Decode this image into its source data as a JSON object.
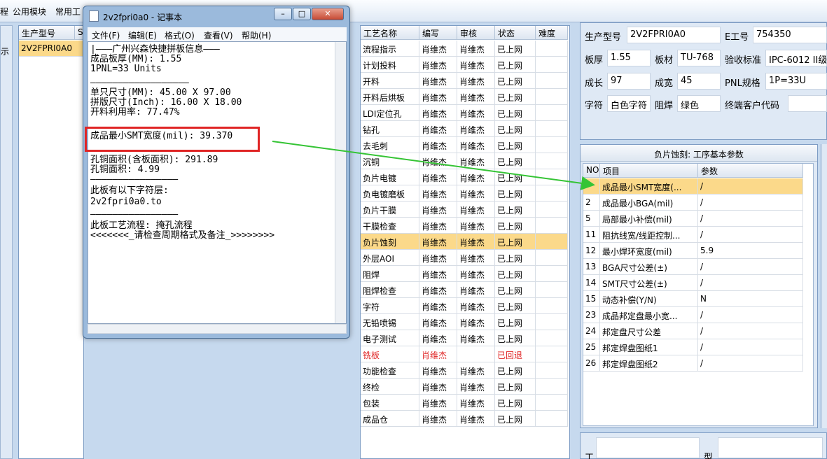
{
  "app_menu": [
    "程",
    "公用模块",
    "常用工"
  ],
  "left_panel_text": "示",
  "model_grid": {
    "header": "生产型号",
    "header2": "S",
    "rows": [
      "2V2FPRI0A0"
    ]
  },
  "notepad": {
    "title": "2v2fpri0a0 - 记事本",
    "menu": [
      "文件(F)",
      "编辑(E)",
      "格式(O)",
      "查看(V)",
      "帮助(H)"
    ],
    "lines": [
      "|———广州兴森快捷拼板信息———",
      "成品板厚(MM): 1.55",
      "1PNL=33 Units",
      "——————————————————",
      "单只尺寸(MM): 45.00 X 97.00",
      "拼版尺寸(Inch): 16.00 X 18.00",
      "开料利用率: 77.47%",
      "",
      "成品最小SMT宽度(mil): 39.370",
      "",
      "孔铜面积(含板面积): 291.89",
      "孔铜面积: 4.99",
      "————————————————",
      "此板有以下字符层:",
      "2v2fpri0a0.to",
      "————————————————",
      "此板工艺流程: 掩孔流程",
      "<<<<<<<_请检查周期格式及备注_>>>>>>>>"
    ]
  },
  "process_grid": {
    "headers": [
      "工艺名称",
      "编写",
      "审核",
      "状态",
      "难度"
    ],
    "rows": [
      [
        "流程指示",
        "肖维杰",
        "肖维杰",
        "已上网"
      ],
      [
        "计划投料",
        "肖维杰",
        "肖维杰",
        "已上网"
      ],
      [
        "开料",
        "肖维杰",
        "肖维杰",
        "已上网"
      ],
      [
        "开料后烘板",
        "肖维杰",
        "肖维杰",
        "已上网"
      ],
      [
        "LDI定位孔",
        "肖维杰",
        "肖维杰",
        "已上网"
      ],
      [
        "钻孔",
        "肖维杰",
        "肖维杰",
        "已上网"
      ],
      [
        "去毛刺",
        "肖维杰",
        "肖维杰",
        "已上网"
      ],
      [
        "沉铜",
        "肖维杰",
        "肖维杰",
        "已上网"
      ],
      [
        "负片电镀",
        "肖维杰",
        "肖维杰",
        "已上网"
      ],
      [
        "负电镀磨板",
        "肖维杰",
        "肖维杰",
        "已上网"
      ],
      [
        "负片干膜",
        "肖维杰",
        "肖维杰",
        "已上网"
      ],
      [
        "干膜检查",
        "肖维杰",
        "肖维杰",
        "已上网"
      ],
      [
        "负片蚀刻",
        "肖维杰",
        "肖维杰",
        "已上网"
      ],
      [
        "外层AOI",
        "肖维杰",
        "肖维杰",
        "已上网"
      ],
      [
        "阻焊",
        "肖维杰",
        "肖维杰",
        "已上网"
      ],
      [
        "阻焊检查",
        "肖维杰",
        "肖维杰",
        "已上网"
      ],
      [
        "字符",
        "肖维杰",
        "肖维杰",
        "已上网"
      ],
      [
        "无铅喷锡",
        "肖维杰",
        "肖维杰",
        "已上网"
      ],
      [
        "电子测试",
        "肖维杰",
        "肖维杰",
        "已上网"
      ],
      [
        "铣板",
        "肖维杰",
        "",
        "已回退"
      ],
      [
        "功能检查",
        "肖维杰",
        "肖维杰",
        "已上网"
      ],
      [
        "终检",
        "肖维杰",
        "肖维杰",
        "已上网"
      ],
      [
        "包装",
        "肖维杰",
        "肖维杰",
        "已上网"
      ],
      [
        "成品仓",
        "肖维杰",
        "肖维杰",
        "已上网"
      ]
    ],
    "selected_index": 12,
    "rejected_index": 19
  },
  "info": {
    "model_label": "生产型号",
    "model": "2V2FPRI0A0",
    "emp_label": "E工号",
    "emp": "754350",
    "thickness_label": "板厚",
    "thickness": "1.55",
    "material_label": "板材",
    "material": "TU-768",
    "standard_label": "验收标准",
    "standard": "IPC-6012 II级",
    "length_label": "成长",
    "length": "97",
    "width_label": "成宽",
    "width": "45",
    "pnl_label": "PNL规格",
    "pnl": "1P=33U",
    "char_label": "字符",
    "char": "白色字符",
    "mask_label": "阻焊",
    "mask": "绿色",
    "customer_label": "终端客户代码",
    "customer": ""
  },
  "params": {
    "title": "负片蚀刻: 工序基本参数",
    "headers": [
      "NO",
      "项目",
      "参数"
    ],
    "rows": [
      [
        "",
        "成品最小SMT宽度(...",
        "/"
      ],
      [
        "2",
        "成品最小BGA(mil)",
        "/"
      ],
      [
        "5",
        "局部最小补偿(mil)",
        "/"
      ],
      [
        "11",
        "阻抗线宽/线距控制...",
        "/"
      ],
      [
        "12",
        "最小焊环宽度(mil)",
        "5.9"
      ],
      [
        "13",
        "BGA尺寸公差(±)",
        "/"
      ],
      [
        "14",
        "SMT尺寸公差(±)",
        "/"
      ],
      [
        "15",
        "动态补偿(Y/N)",
        "N"
      ],
      [
        "23",
        "成品邦定盘最小宽...",
        "/"
      ],
      [
        "24",
        "邦定盘尺寸公差",
        "/"
      ],
      [
        "25",
        "邦定焊盘图纸1",
        "/"
      ],
      [
        "26",
        "邦定焊盘图纸2",
        "/"
      ]
    ]
  },
  "bottom": {
    "label1": "工",
    "label2": "型"
  },
  "colors": {
    "accent_highlight": "#e02525",
    "arrow": "#35c435",
    "selected_row": "#fbd98a",
    "rejected_text": "#e02525"
  }
}
